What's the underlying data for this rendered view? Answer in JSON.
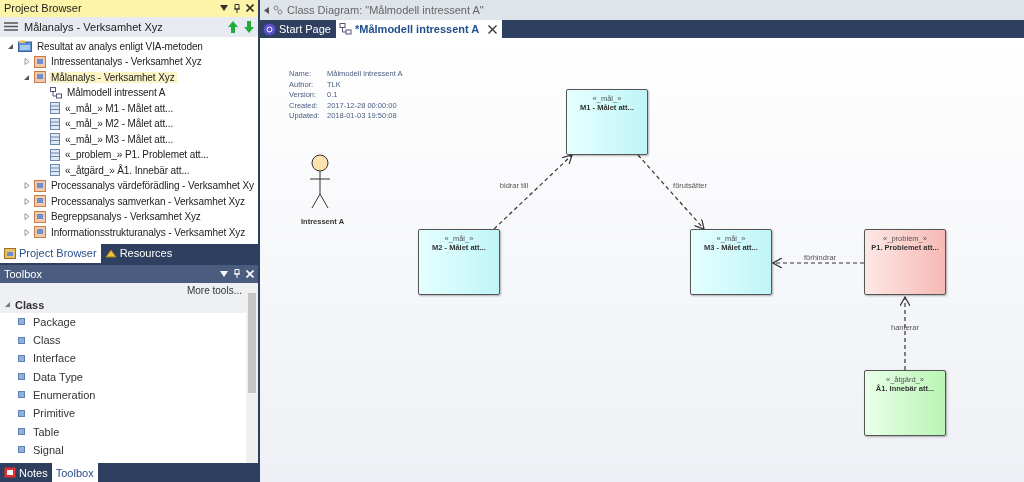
{
  "project_browser": {
    "title": "Project Browser",
    "toolbar_label": "Målanalys - Verksamhet Xyz",
    "tree": [
      {
        "label": "Resultat av analys enligt VIA-metoden",
        "kind": "root",
        "expanded": true,
        "selected": false,
        "children": [
          {
            "label": "Intressentanalys - Verksamhet Xyz",
            "kind": "package",
            "expanded": false,
            "selected": false
          },
          {
            "label": "Målanalys - Verksamhet Xyz",
            "kind": "package",
            "expanded": true,
            "selected": true,
            "children": [
              {
                "label": "Målmodell intressent A",
                "kind": "diagram"
              },
              {
                "label": "«_mål_» M1 - Målet att...",
                "kind": "element"
              },
              {
                "label": "«_mål_» M2 - Målet att...",
                "kind": "element"
              },
              {
                "label": "«_mål_» M3 - Målet att...",
                "kind": "element"
              },
              {
                "label": "«_problem_» P1. Problemet att...",
                "kind": "element"
              },
              {
                "label": "«_åtgärd_» Å1. Innebär att...",
                "kind": "element"
              }
            ]
          },
          {
            "label": "Processanalys värdeförädling - Verksamhet Xy",
            "kind": "package",
            "expanded": false,
            "selected": false
          },
          {
            "label": "Processanalys samverkan - Verksamhet Xyz",
            "kind": "package",
            "expanded": false,
            "selected": false
          },
          {
            "label": "Begreppsanalys - Verksamhet Xyz",
            "kind": "package",
            "expanded": false,
            "selected": false
          },
          {
            "label": "Informationsstrukturanalys - Verksamhet Xyz",
            "kind": "package",
            "expanded": false,
            "selected": false
          }
        ]
      }
    ],
    "tabs": [
      {
        "label": "Project Browser",
        "selected": true
      },
      {
        "label": "Resources",
        "selected": false
      }
    ]
  },
  "toolbox": {
    "title": "Toolbox",
    "more_tools": "More tools...",
    "section": "Class",
    "items": [
      "Package",
      "Class",
      "Interface",
      "Data Type",
      "Enumeration",
      "Primitive",
      "Table",
      "Signal"
    ],
    "tabs": [
      {
        "label": "Notes",
        "selected": false
      },
      {
        "label": "Toolbox",
        "selected": true
      }
    ]
  },
  "diagram": {
    "header": "Class Diagram: \"Målmodell intressent A\"",
    "tabs": [
      {
        "label": "Start Page",
        "selected": false
      },
      {
        "label": "*Målmodell intressent A",
        "selected": true
      }
    ],
    "info": [
      {
        "key": "Name:",
        "value": "Målmodell intressent A"
      },
      {
        "key": "Author:",
        "value": "TLK"
      },
      {
        "key": "Version:",
        "value": "0.1"
      },
      {
        "key": "Created:",
        "value": "2017-12-28 00:00:00"
      },
      {
        "key": "Updated:",
        "value": "2018-01-03 19:50:08"
      }
    ],
    "actor": "Intressent A",
    "nodes": [
      {
        "stereotype": "«_mål_»",
        "name": "M1 - Målet att...",
        "kind": "goal"
      },
      {
        "stereotype": "«_mål_»",
        "name": "M2 - Målet att...",
        "kind": "goal"
      },
      {
        "stereotype": "«_mål_»",
        "name": "M3 - Målet att...",
        "kind": "goal"
      },
      {
        "stereotype": "«_problem_»",
        "name": "P1. Problemet att...",
        "kind": "problem"
      },
      {
        "stereotype": "«_åtgärd_»",
        "name": "Å1. Innebär att...",
        "kind": "action"
      }
    ],
    "edges": [
      {
        "label": "bidrar till"
      },
      {
        "label": "förutsätter"
      },
      {
        "label": "förhindrar"
      },
      {
        "label": "hanterar"
      }
    ]
  }
}
